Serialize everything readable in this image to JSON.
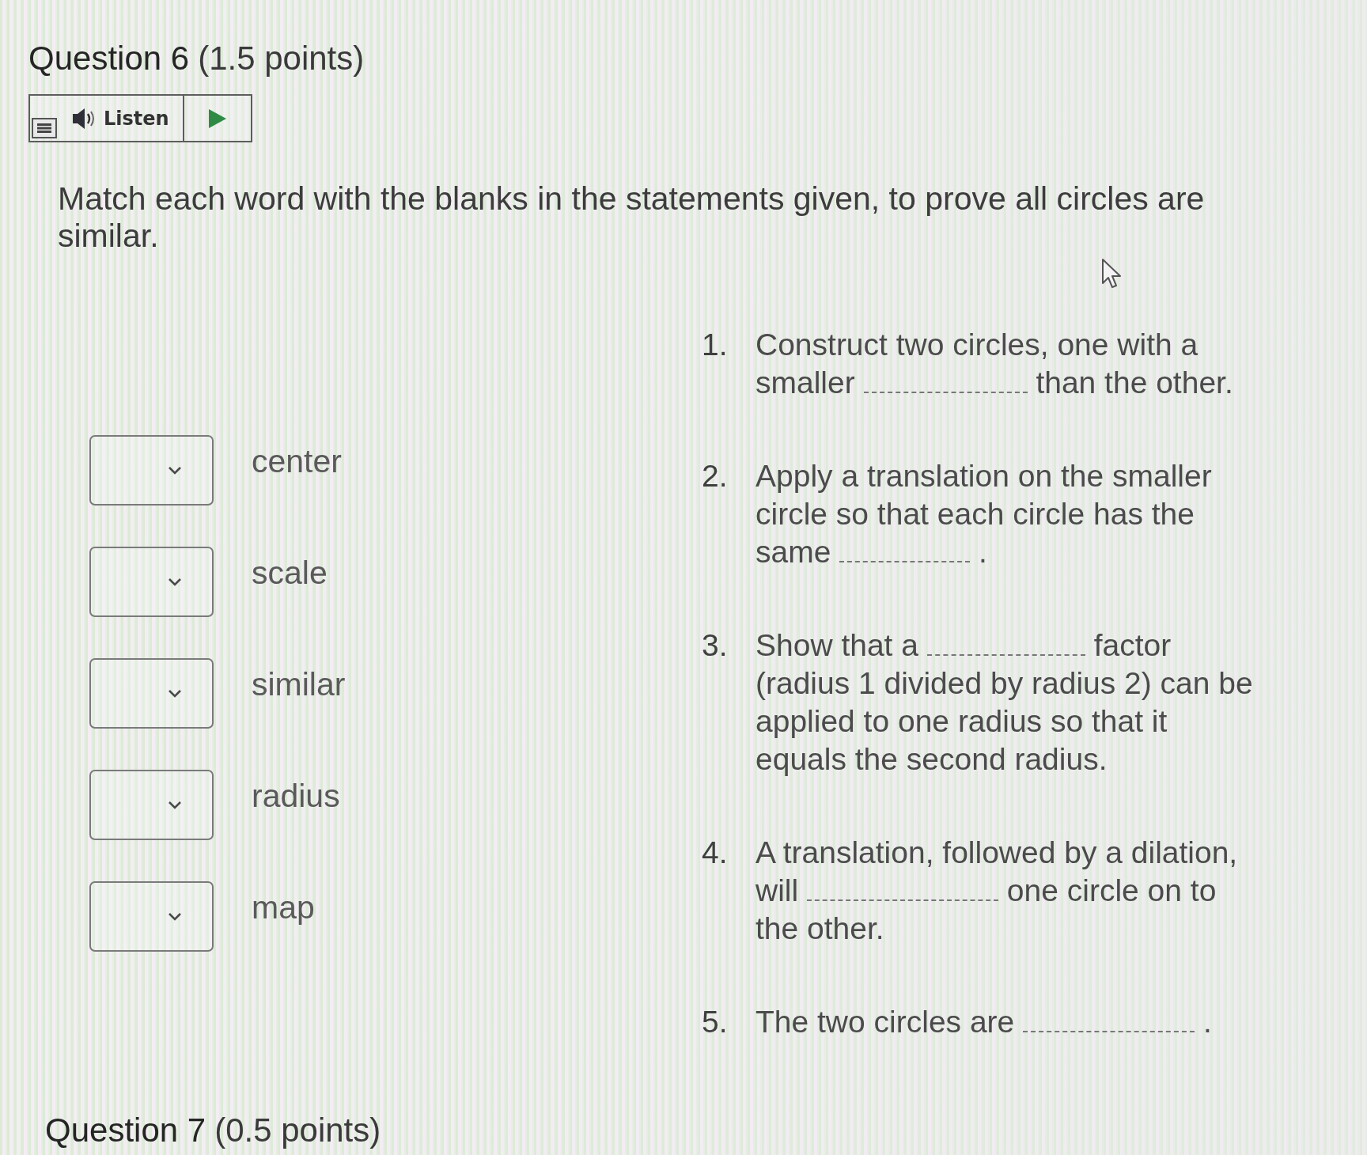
{
  "question": {
    "title": "Question 6",
    "points": "(1.5 points)"
  },
  "listen": {
    "label": "Listen"
  },
  "instructions": "Match each word with the blanks in the statements given, to prove all circles are similar.",
  "words": [
    "center",
    "scale",
    "similar",
    "radius",
    "map"
  ],
  "statements": [
    {
      "number": "1.",
      "before": "Construct two circles, one with a smaller",
      "after": "than the other."
    },
    {
      "number": "2.",
      "before": "Apply a translation on the smaller circle so that each circle has the same",
      "after": "."
    },
    {
      "number": "3.",
      "before": "Show that a",
      "after": "factor (radius 1 divided by radius 2) can be applied to one radius so that it equals the second radius."
    },
    {
      "number": "4.",
      "before": "A translation, followed by a dilation, will",
      "after": "one circle on to the other."
    },
    {
      "number": "5.",
      "before": "The two circles are",
      "after": "."
    }
  ],
  "next_question": {
    "title": "Question 7",
    "points": "(0.5 points)"
  }
}
